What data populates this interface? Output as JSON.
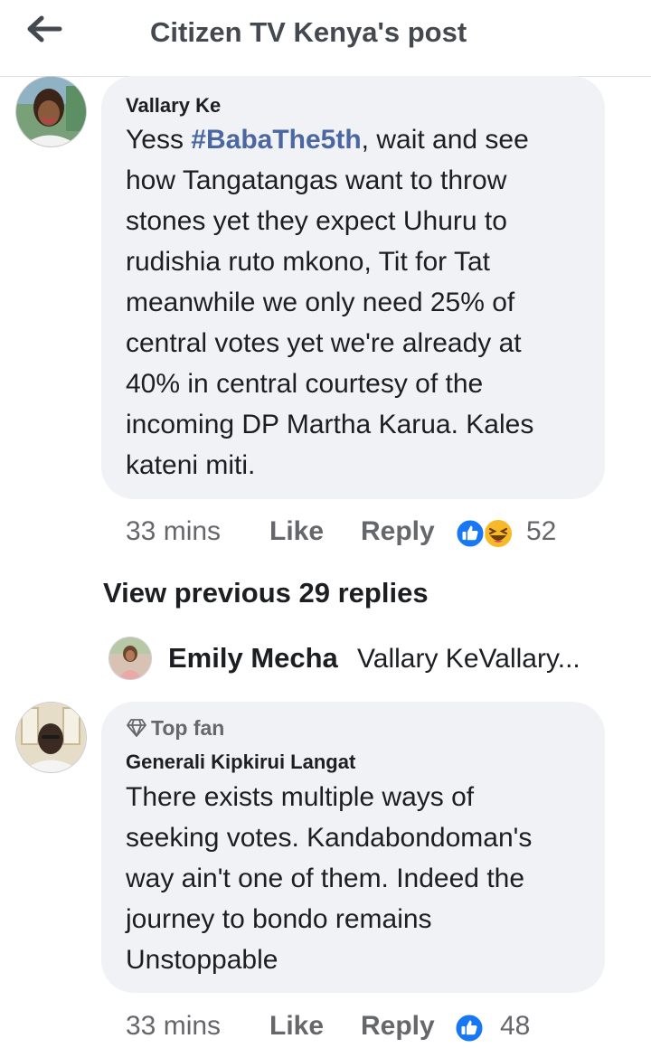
{
  "header": {
    "title": "Citizen TV Kenya's post",
    "back_icon": "arrow-left-icon"
  },
  "comments": [
    {
      "author": "Vallary Ke",
      "text_prefix": "Yess ",
      "hashtag": "#BabaThe5th",
      "text_lines": [
        ", wait and see",
        "how Tangatangas want to throw",
        "stones yet they expect Uhuru to",
        "rudishia ruto mkono, Tit for Tat",
        "meanwhile we only need 25% of",
        "central votes yet we're already at",
        "40% in central  courtesy of the",
        "incoming DP Martha Karua. Kales",
        "kateni miti."
      ],
      "time": "33 mins",
      "like_label": "Like",
      "reply_label": "Reply",
      "reactions": [
        "like",
        "haha"
      ],
      "reaction_count": "52",
      "view_previous": "View previous 29 replies",
      "reply_preview": {
        "author": "Emily Mecha",
        "snippet": "Vallary KeVallary..."
      }
    },
    {
      "badge": "Top fan",
      "author": "Generali Kipkirui Langat",
      "text_lines": [
        "There exists multiple ways of",
        "seeking votes. Kandabondoman's",
        "way ain't one of them. Indeed the",
        "journey to bondo remains",
        "Unstoppable"
      ],
      "time": "33 mins",
      "like_label": "Like",
      "reply_label": "Reply",
      "reactions": [
        "like"
      ],
      "reaction_count": "48"
    }
  ],
  "colors": {
    "bubble": "#f0f2f5",
    "hashtag": "#4b67a1",
    "meta": "#65676b",
    "like_blue": "#1877f2",
    "haha_yellow": "#f7b928"
  }
}
